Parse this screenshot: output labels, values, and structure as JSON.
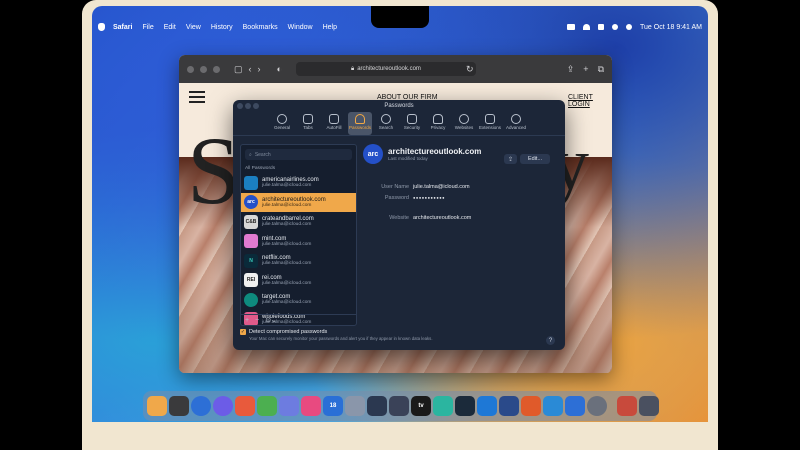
{
  "menubar": {
    "app": "Safari",
    "items": [
      "File",
      "Edit",
      "View",
      "History",
      "Bookmarks",
      "Window",
      "Help"
    ],
    "clock": "Tue Oct 18  9:41 AM"
  },
  "safari": {
    "url": "architectureoutlook.com",
    "site": {
      "about_link": "ABOUT OUR FIRM",
      "client_link": "CLIENT LOGIN",
      "hero_left": "S",
      "hero_right": "y"
    }
  },
  "passwords": {
    "title": "Passwords",
    "tabs": [
      {
        "label": "General",
        "icon": "gear-icon"
      },
      {
        "label": "Tabs",
        "icon": "tabs-icon"
      },
      {
        "label": "AutoFill",
        "icon": "autofill-icon"
      },
      {
        "label": "Passwords",
        "icon": "key-icon"
      },
      {
        "label": "Search",
        "icon": "search-icon"
      },
      {
        "label": "Security",
        "icon": "lock-icon"
      },
      {
        "label": "Privacy",
        "icon": "hand-icon"
      },
      {
        "label": "Websites",
        "icon": "globe-icon"
      },
      {
        "label": "Extensions",
        "icon": "puzzle-icon"
      },
      {
        "label": "Advanced",
        "icon": "gears-icon"
      }
    ],
    "active_tab": "Passwords",
    "search_placeholder": "Search",
    "list_header": "All Passwords",
    "items": [
      {
        "site": "americanairlines.com",
        "user": "julie.talma@icloud.com",
        "color": "#1b7fc1",
        "badge": ""
      },
      {
        "site": "architectureoutlook.com",
        "user": "julie.talma@icloud.com",
        "color": "#2450c8",
        "badge": "arc"
      },
      {
        "site": "crateandbarrel.com",
        "user": "julie.talma@icloud.com",
        "color": "#d8d8d8",
        "badge": "C&B"
      },
      {
        "site": "mint.com",
        "user": "julie.talma@icloud.com",
        "color": "#e07ad0",
        "badge": ""
      },
      {
        "site": "netflix.com",
        "user": "julie.talma@icloud.com",
        "color": "#0a2a3a",
        "badge": "N"
      },
      {
        "site": "rei.com",
        "user": "julie.talma@icloud.com",
        "color": "#f0f0f0",
        "badge": "REI"
      },
      {
        "site": "target.com",
        "user": "julie.talma@icloud.com",
        "color": "#0e8a7e",
        "badge": ""
      },
      {
        "site": "wholefoods.com",
        "user": "julie.talma@icloud.com",
        "color": "#e05a8a",
        "badge": ""
      }
    ],
    "detail": {
      "badge": "arc",
      "site": "architectureoutlook.com",
      "modified": "Last modified today",
      "edit_label": "Edit...",
      "user_label": "User Name",
      "user_value": "julie.talma@icloud.com",
      "password_label": "Password",
      "password_value": "●●●●●●●●●●●",
      "website_label": "Website",
      "website_value": "architectureoutlook.com"
    },
    "detect_label": "Detect compromised passwords",
    "detect_desc": "Your Mac can securely monitor your passwords and alert you if they appear in known data leaks.",
    "help": "?"
  },
  "dock": {
    "calendar_day": "18",
    "apps": [
      {
        "name": "finder",
        "color": "#f0a84a",
        "label": ""
      },
      {
        "name": "launchpad",
        "color": "#3a3a3c",
        "label": ""
      },
      {
        "name": "safari",
        "color": "#2d6fd6",
        "label": ""
      },
      {
        "name": "messages",
        "color": "#6c5ce7",
        "label": ""
      },
      {
        "name": "mail",
        "color": "#e85a3c",
        "label": ""
      },
      {
        "name": "maps",
        "color": "#4caf50",
        "label": ""
      },
      {
        "name": "photos",
        "color": "#6d7ce0",
        "label": ""
      },
      {
        "name": "facetime",
        "color": "#e84a80",
        "label": ""
      },
      {
        "name": "calendar",
        "color": "#2a6fd6",
        "label": "18"
      },
      {
        "name": "contacts",
        "color": "#8a96aa",
        "label": ""
      },
      {
        "name": "reminders",
        "color": "#2b3850",
        "label": ""
      },
      {
        "name": "notes",
        "color": "#3a4258",
        "label": ""
      },
      {
        "name": "tv",
        "color": "#1a1a1a",
        "label": "tv"
      },
      {
        "name": "music",
        "color": "#2bb5a0",
        "label": ""
      },
      {
        "name": "podcasts",
        "color": "#1b2a3a",
        "label": ""
      },
      {
        "name": "news",
        "color": "#1e78d6",
        "label": ""
      },
      {
        "name": "keynote",
        "color": "#2a4a8a",
        "label": ""
      },
      {
        "name": "numbers",
        "color": "#e05a2a",
        "label": ""
      },
      {
        "name": "pages",
        "color": "#2a8ad6",
        "label": ""
      },
      {
        "name": "app-store",
        "color": "#2d6fd6",
        "label": ""
      },
      {
        "name": "system-settings",
        "color": "#6a707c",
        "label": ""
      },
      {
        "name": "downloads",
        "color": "#c84a3c",
        "label": ""
      },
      {
        "name": "trash",
        "color": "#4a5060",
        "label": ""
      }
    ]
  }
}
